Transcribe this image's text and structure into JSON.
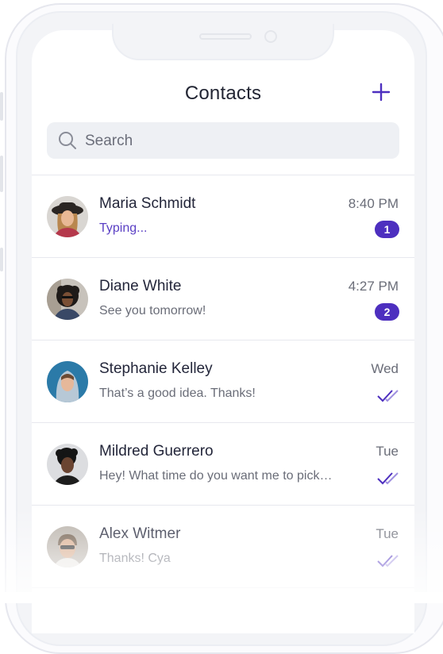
{
  "header": {
    "title": "Contacts",
    "add_icon": "plus-icon"
  },
  "search": {
    "placeholder": "Search",
    "icon": "search-icon"
  },
  "accent_color": "#4d2fbf",
  "contacts": [
    {
      "name": "Maria Schmidt",
      "message": "Typing...",
      "time": "8:40 PM",
      "unread": "1",
      "typing": true,
      "status": "unread"
    },
    {
      "name": "Diane White",
      "message": "See you tomorrow!",
      "time": "4:27 PM",
      "unread": "2",
      "status": "unread"
    },
    {
      "name": "Stephanie Kelley",
      "message": "That’s a good idea. Thanks!",
      "time": "Wed",
      "status": "read",
      "icon": "double-check-icon"
    },
    {
      "name": "Mildred Guerrero",
      "message": "Hey! What time do you want me to pick…",
      "time": "Tue",
      "status": "read",
      "icon": "double-check-icon"
    },
    {
      "name": "Alex Witmer",
      "message": "Thanks! Cya",
      "time": "Tue",
      "status": "read",
      "icon": "double-check-icon"
    }
  ]
}
